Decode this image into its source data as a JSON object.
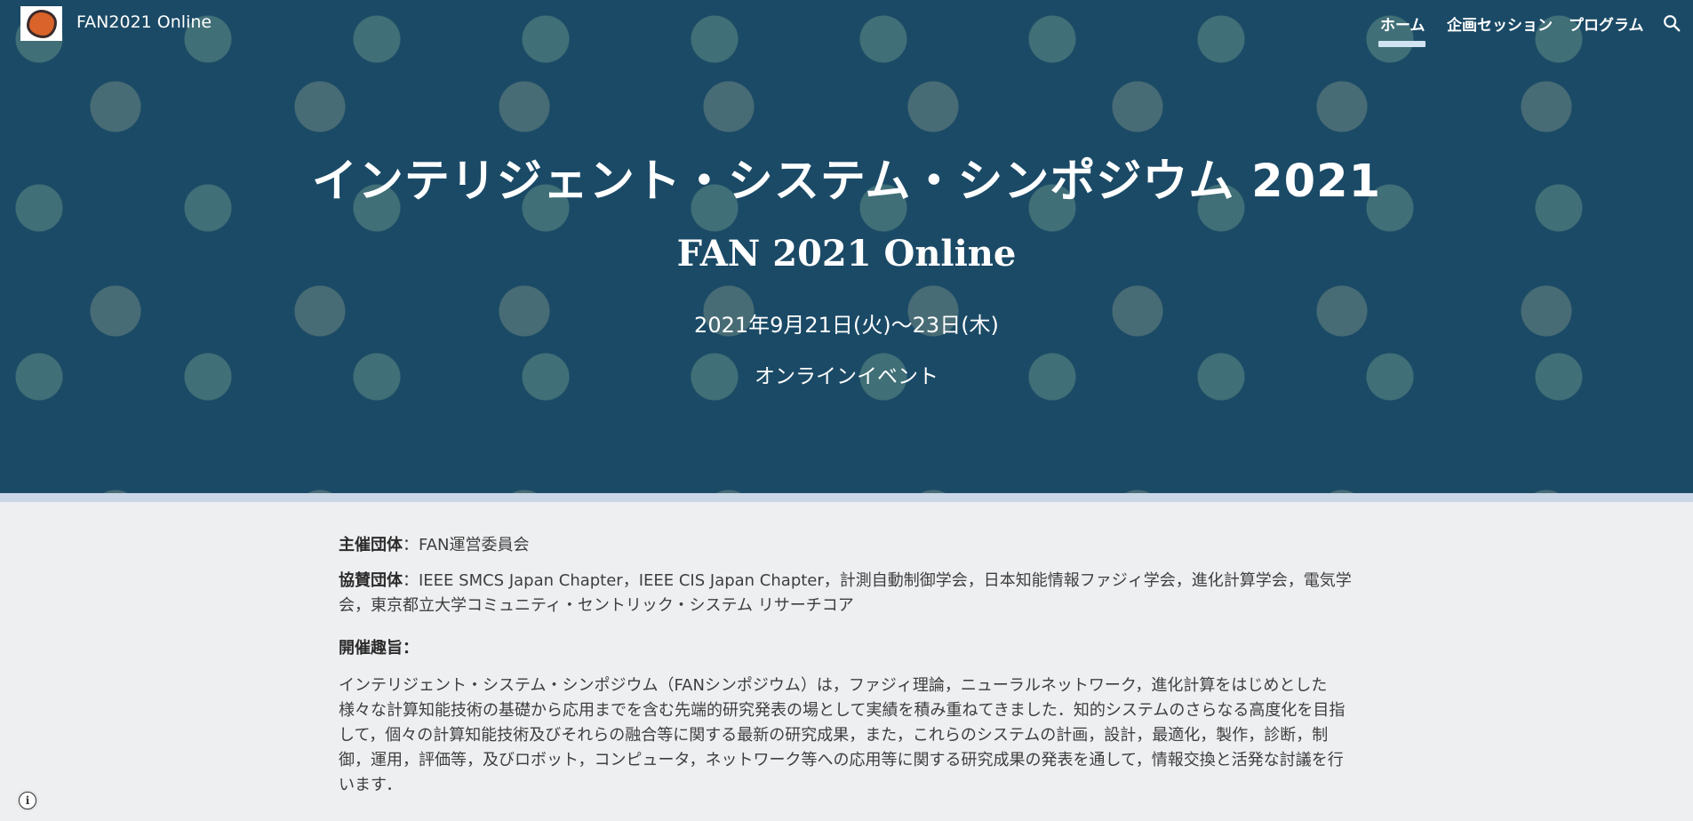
{
  "site": {
    "title": "FAN2021 Online"
  },
  "nav": {
    "home": "ホーム",
    "session": "企画セッション",
    "program": "プログラム"
  },
  "hero": {
    "title": "インテリジェント・システム・シンポジウム 2021",
    "subtitle": "FAN 2021 Online",
    "date": "2021年9月21日(火)〜23日(木)",
    "venue": "オンラインイベント"
  },
  "content": {
    "organizer_label": "主催団体",
    "organizer_value": "：FAN運営委員会",
    "cosponsor_label": "協賛団体",
    "cosponsor_value": "：IEEE SMCS Japan Chapter，IEEE CIS Japan Chapter，計測自動制御学会，日本知能情報ファジィ学会，進化計算学会，電気学会，東京都立大学コミュニティ・セントリック・システム リサーチコア",
    "purpose_heading": "開催趣旨：",
    "purpose_text": "インテリジェント・システム・シンポジウム（FANシンポジウム）は，ファジィ理論，ニューラルネットワーク，進化計算をはじめとした様々な計算知能技術の基礎から応用までを含む先端的研究発表の場として実績を積み重ねてきました．知的システムのさらなる高度化を目指して，個々の計算知能技術及びそれらの融合等に関する最新の研究成果，また，これらのシステムの計画，設計，最適化，製作，診断，制御，運用，評価等，及びロボット，コンピュータ，ネットワーク等への応用等に関する研究成果の発表を通して，情報交換と活発な討議を行います．"
  },
  "colors": {
    "hero_bg": "#1e4f6c",
    "page_bg": "#eeeff1",
    "logo_accent": "#d9632a"
  },
  "icons": {
    "search": "search-icon",
    "info": "info-icon",
    "logo": "site-logo"
  }
}
